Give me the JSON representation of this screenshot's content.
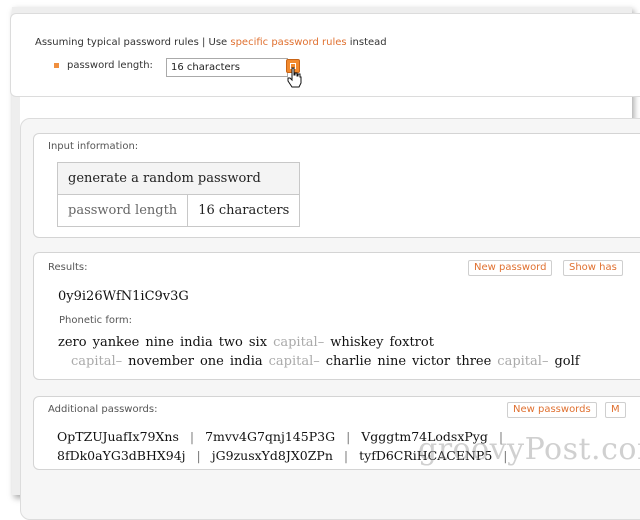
{
  "settings": {
    "assume_prefix": "Assuming typical password rules | Use",
    "specific_link": "specific password rules",
    "assume_suffix": "instead",
    "pw_length_label": "password length:",
    "pw_length_value": "16 characters"
  },
  "input_info": {
    "title": "Input information:",
    "header": "generate a random password",
    "key": "password length",
    "value": "16 characters"
  },
  "results": {
    "title": "Results:",
    "new_password_button": "New password",
    "show_hash_button": "Show has",
    "password": "0y9i26WfN1iC9v3G",
    "phonetic_title": "Phonetic form:",
    "phonetic_line1": [
      {
        "w": "zero",
        "cap": false
      },
      {
        "w": "yankee",
        "cap": false
      },
      {
        "w": "nine",
        "cap": false
      },
      {
        "w": "india",
        "cap": false
      },
      {
        "w": "two",
        "cap": false
      },
      {
        "w": "six",
        "cap": false
      },
      {
        "w": "capital–",
        "cap": true
      },
      {
        "w": "whiskey",
        "cap": false
      },
      {
        "w": "foxtrot",
        "cap": false
      }
    ],
    "phonetic_line2": [
      {
        "w": "capital–",
        "cap": true
      },
      {
        "w": "november",
        "cap": false
      },
      {
        "w": "one",
        "cap": false
      },
      {
        "w": "india",
        "cap": false
      },
      {
        "w": "capital–",
        "cap": true
      },
      {
        "w": "charlie",
        "cap": false
      },
      {
        "w": "nine",
        "cap": false
      },
      {
        "w": "victor",
        "cap": false
      },
      {
        "w": "three",
        "cap": false
      },
      {
        "w": "capital–",
        "cap": true
      },
      {
        "w": "golf",
        "cap": false
      }
    ]
  },
  "additional": {
    "title": "Additional passwords:",
    "new_passwords_button": "New passwords",
    "more_button": "M",
    "row1": [
      "OpTZUJuafIx79Xns",
      "7mvv4G7qnj145P3G",
      "Vgggtm74LodsxPyg"
    ],
    "row2": [
      "8fDk0aYG3dBHX94j",
      "jG9zusxYd8JX0ZPn",
      "tyfD6CRiHCACENP5"
    ]
  },
  "watermark": "groovyPost.com"
}
